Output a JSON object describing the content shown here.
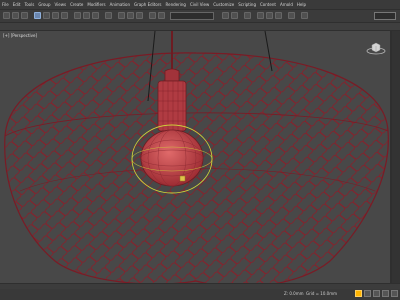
{
  "menu": {
    "items": [
      "File",
      "Edit",
      "Tools",
      "Group",
      "Views",
      "Create",
      "Modifiers",
      "Animation",
      "Graph Editors",
      "Rendering",
      "Civil View",
      "Customize",
      "Scripting",
      "Content",
      "Arnold",
      "Help"
    ]
  },
  "toolbar": {
    "dropdown_value": "",
    "search_placeholder": ""
  },
  "ribbon": {
    "labels": [
      "",
      "",
      ""
    ]
  },
  "viewport": {
    "label": "[+] [Perspective]",
    "colors": {
      "background": "#484848",
      "wireframe": "#8a1f2a",
      "bulb_fill": "#c94b4b",
      "selection": "#cfd43a"
    }
  },
  "status": {
    "message": "",
    "x_value": "",
    "y_value": "",
    "z_value": "Z: 0.0mm",
    "grid": "Grid = 10.0mm"
  },
  "icons": [
    "move-icon",
    "rotate-icon",
    "scale-icon",
    "select-icon",
    "render-icon",
    "zoom-icon",
    "pan-icon",
    "orbit-icon"
  ]
}
